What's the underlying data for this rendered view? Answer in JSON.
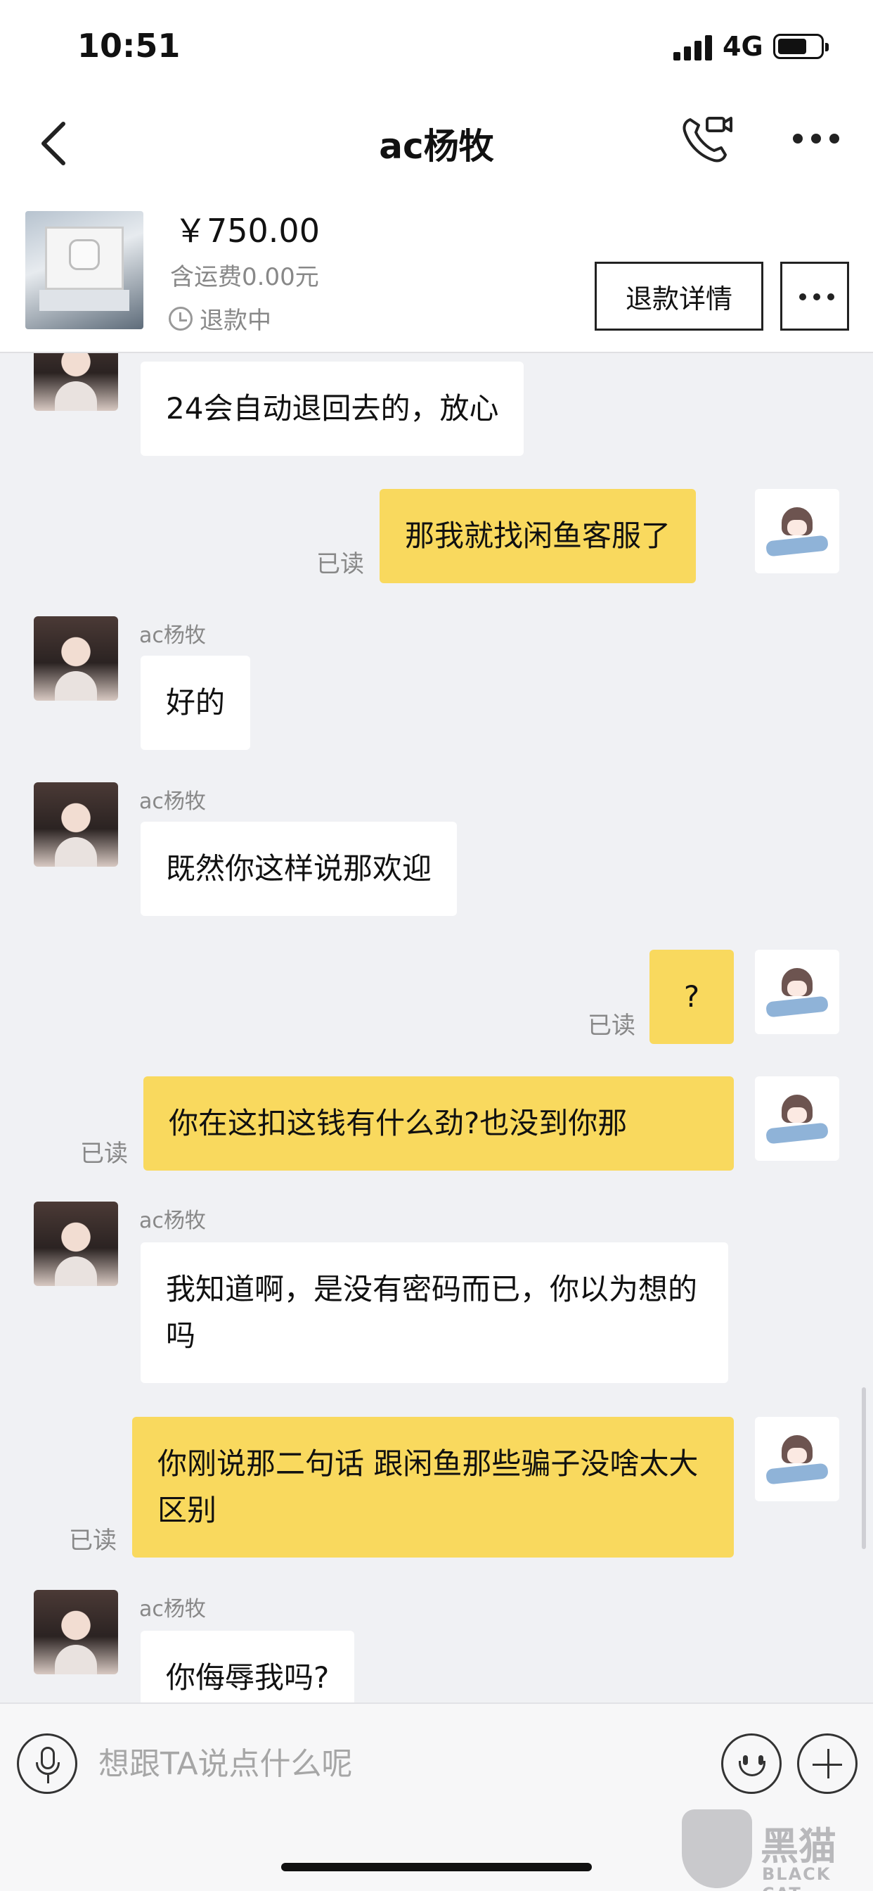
{
  "status_bar": {
    "time": "10:51",
    "network": "4G"
  },
  "nav": {
    "title": "ac杨牧"
  },
  "product": {
    "price": "￥750.00",
    "shipping": "含运费0.00元",
    "status": "退款中",
    "refund_button": "退款详情"
  },
  "messages": [
    {
      "side": "left",
      "text": "24会自动退回去的，放心"
    },
    {
      "side": "right",
      "text": "那我就找闲鱼客服了",
      "read": "已读"
    },
    {
      "side": "left",
      "sender": "ac杨牧",
      "text": "好的"
    },
    {
      "side": "left",
      "sender": "ac杨牧",
      "text": "既然你这样说那欢迎"
    },
    {
      "side": "right",
      "text": "?",
      "read": "已读"
    },
    {
      "side": "right",
      "text": "你在这扣这钱有什么劲?也没到你那",
      "read": "已读"
    },
    {
      "side": "left",
      "sender": "ac杨牧",
      "text": "我知道啊，是没有密码而已，你以为想的吗"
    },
    {
      "side": "right",
      "text": "你刚说那二句话 跟闲鱼那些骗子没啥太大区别",
      "read": "已读"
    },
    {
      "side": "left",
      "sender": "ac杨牧",
      "text": "你侮辱我吗?"
    }
  ],
  "input": {
    "placeholder": "想跟TA说点什么呢"
  },
  "watermark": {
    "text": "黑猫",
    "sub": "BLACK CAT"
  }
}
